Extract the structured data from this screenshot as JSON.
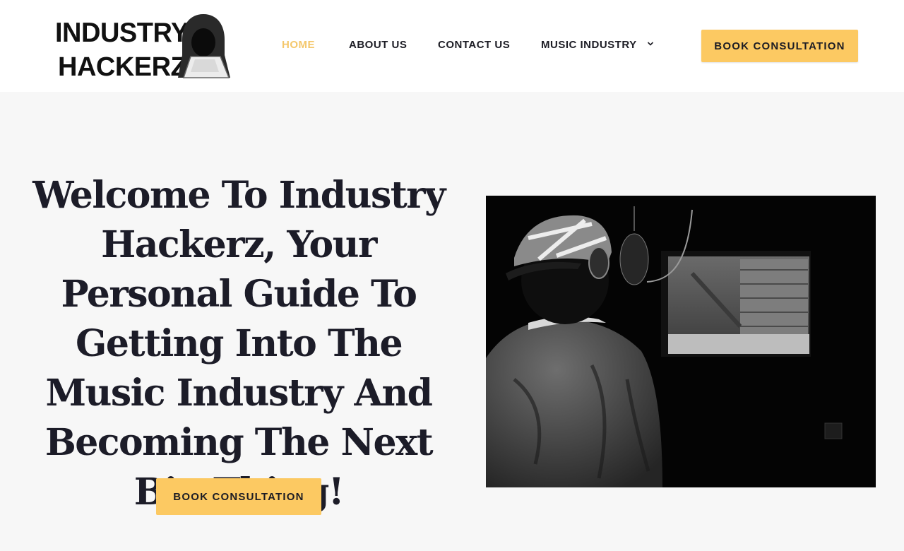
{
  "header": {
    "logo": {
      "line1": "INDUSTRY",
      "line2": "HACKERZ",
      "icon": "hooded-hacker-icon"
    },
    "nav": [
      {
        "label": "HOME",
        "active": true
      },
      {
        "label": "ABOUT US",
        "active": false
      },
      {
        "label": "CONTACT US",
        "active": false
      },
      {
        "label": "MUSIC INDUSTRY",
        "active": false,
        "icon": "chevron-down-icon"
      }
    ],
    "cta_label": "BOOK CONSULTATION"
  },
  "hero": {
    "title": "Welcome To Industry Hackerz, Your Personal Guide To Getting Into The Music Industry And Becoming The Next Big Thing!",
    "cta_label": "BOOK CONSULTATION",
    "image": "recording-studio-photo"
  },
  "colors": {
    "accent": "#fcc962",
    "active_nav": "#f4c76b",
    "text": "#1c1c24",
    "background": "#f7f7f7",
    "header_bg": "#ffffff"
  }
}
